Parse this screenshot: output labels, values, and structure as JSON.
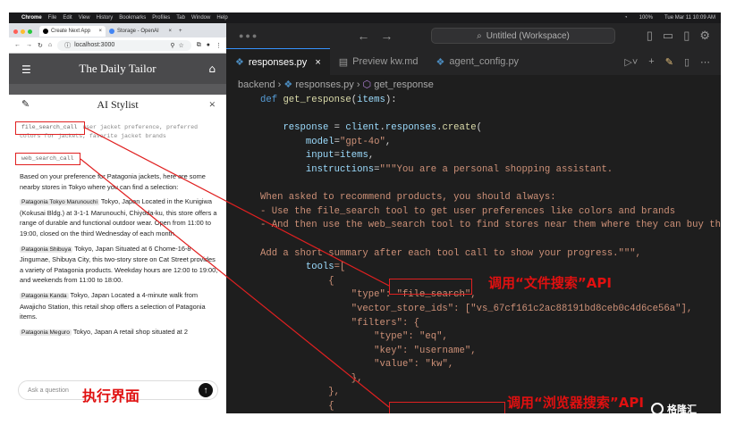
{
  "menubar": {
    "app": "Chrome",
    "items": [
      "File",
      "Edit",
      "View",
      "History",
      "Bookmarks",
      "Profiles",
      "Tab",
      "Window",
      "Help"
    ],
    "clock": "Tue Mar 11 10:09 AM",
    "battery": "100%"
  },
  "browser": {
    "tabs": [
      "Create Next App",
      "Storage - OpenAI"
    ],
    "url": "localhost:3000"
  },
  "app": {
    "brand": "The Daily Tailor",
    "panel_title": "AI Stylist",
    "tool_call_1": "file_search_call",
    "tool_call_1_args": "user jacket preference, preferred colors for jackets, favorite jacket brands",
    "tool_call_2": "web_search_call",
    "intro": "Based on your preference for Patagonia jackets, here are some nearby stores in Tokyo where you can find a selection:",
    "stores": [
      {
        "name": "Patagonia Tokyo Marunouchi",
        "text": "Tokyo, Japan Located in the Kunigiwa (Kokusai Bldg.) at 3-1-1 Marunouchi, Chiyoda-ku, this store offers a range of durable and functional outdoor wear. Open from 11:00 to 19:00, closed on the third Wednesday of each month."
      },
      {
        "name": "Patagonia Shibuya",
        "text": "Tokyo, Japan Situated at 6 Chome-16-8 Jingumae, Shibuya City, this two-story store on Cat Street provides a variety of Patagonia products. Weekday hours are 12:00 to 19:00, and weekends from 11:00 to 18:00."
      },
      {
        "name": "Patagonia Kanda",
        "text": "Tokyo, Japan Located a 4-minute walk from Awajicho Station, this retail shop offers a selection of Patagonia items."
      },
      {
        "name": "Patagonia Meguro",
        "text": "Tokyo, Japan A retail shop situated at 2"
      }
    ],
    "ask_placeholder": "Ask a question"
  },
  "annotations": {
    "exec_label": "执行界面",
    "file_api": "调用“文件搜索”API",
    "browser_api": "调用“浏览器搜索”API"
  },
  "editor": {
    "search": "Untitled (Workspace)",
    "tabs": [
      {
        "label": "responses.py",
        "active": true
      },
      {
        "label": "Preview kw.md",
        "active": false
      },
      {
        "label": "agent_config.py",
        "active": false
      }
    ],
    "breadcrumb": [
      "backend",
      "responses.py",
      "get_response"
    ]
  },
  "watermark": "格隆汇"
}
